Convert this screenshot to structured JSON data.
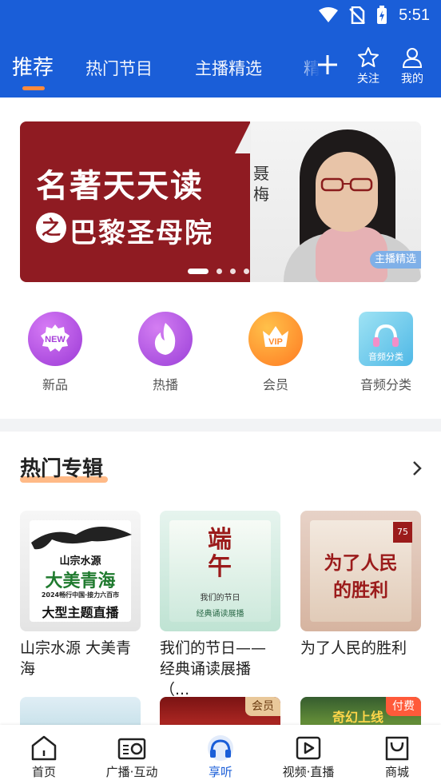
{
  "status_bar": {
    "time": "5:51",
    "icons": [
      "wifi-icon",
      "no-sim-icon",
      "battery-charging-icon"
    ]
  },
  "top_nav": {
    "tabs": [
      {
        "label": "推荐",
        "active": true
      },
      {
        "label": "热门节目",
        "active": false
      },
      {
        "label": "主播精选",
        "active": false
      },
      {
        "label": "精",
        "active": false
      }
    ],
    "actions": [
      {
        "icon": "plus-icon",
        "label": ""
      },
      {
        "icon": "star-icon",
        "label": "关注"
      },
      {
        "icon": "user-icon",
        "label": "我的"
      }
    ],
    "accent": "#ff8a3c",
    "background": "#1a5ed8"
  },
  "banner": {
    "title_line1": "名著天天读",
    "title_circle": "之",
    "title_line2": "巴黎圣母院",
    "host": "聂梅",
    "tag": "主播精选",
    "slides": 4,
    "active_slide": 1
  },
  "quick_entries": [
    {
      "label": "新品",
      "icon": "new-badge-icon",
      "badge_text": "NEW",
      "color": "#b044e0"
    },
    {
      "label": "热播",
      "icon": "flame-icon",
      "color": "#a94ae0"
    },
    {
      "label": "会员",
      "icon": "vip-crown-icon",
      "badge_text": "VIP",
      "color": "#ff8a2a"
    },
    {
      "label": "音频分类",
      "icon": "headphones-icon",
      "badge_text": "音频分类",
      "color": "#5cc0e8"
    }
  ],
  "hot_albums": {
    "title": "热门专辑",
    "items": [
      {
        "title": "山宗水源 大美青海",
        "cover_text1": "山宗水源",
        "cover_text2": "大美青海",
        "cover_text3": "2024畅行中国·接力六百市",
        "cover_text4": "大型主题直播"
      },
      {
        "title": "我们的节日——经典诵读展播（...",
        "cover_text1": "端午",
        "cover_text2": "我们的节日",
        "cover_text3": "经典诵读展播"
      },
      {
        "title": "为了人民的胜利",
        "cover_text1": "为了人民",
        "cover_text2": "的胜利",
        "cover_text3": "75"
      }
    ],
    "more_items": [
      {
        "badge": ""
      },
      {
        "badge": "会员"
      },
      {
        "badge": "付费",
        "cover_text": "奇幻上线"
      }
    ]
  },
  "bottom_nav": [
    {
      "label": "首页",
      "icon": "home-icon",
      "active": false
    },
    {
      "label": "广播·互动",
      "icon": "radio-icon",
      "active": false
    },
    {
      "label": "享听",
      "icon": "headphones-icon",
      "active": true
    },
    {
      "label": "视频·直播",
      "icon": "video-play-icon",
      "active": false
    },
    {
      "label": "商城",
      "icon": "shopping-bag-icon",
      "active": false
    }
  ]
}
